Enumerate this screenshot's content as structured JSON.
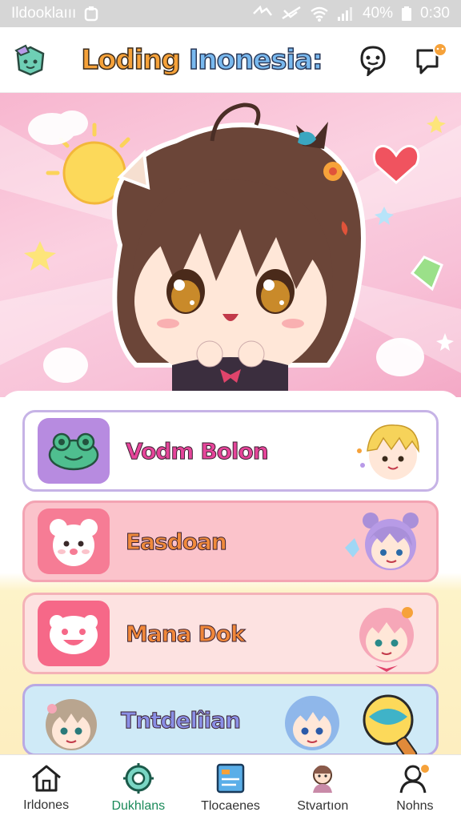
{
  "status_bar": {
    "carrier": "Ildooklaııı",
    "battery": "40%",
    "time": "0:30"
  },
  "header": {
    "title_part1": "Loding",
    "title_part2": "Inonesia:",
    "icons": [
      "chat-face-icon",
      "notification-icon"
    ]
  },
  "cards": [
    {
      "label": "Vodm Bolon",
      "icon": "frog-icon"
    },
    {
      "label": "Easdoan",
      "icon": "bear-icon"
    },
    {
      "label": "Mana Dok",
      "icon": "bear-face-icon"
    },
    {
      "label": "Tntdelîian",
      "icon": "chibi-girl-icon"
    }
  ],
  "bottom_nav": [
    {
      "label": "Irldones",
      "icon": "home-icon"
    },
    {
      "label": "Dukhlans",
      "icon": "gear-icon"
    },
    {
      "label": "Tlocaenes",
      "icon": "document-icon"
    },
    {
      "label": "Stvartıon",
      "icon": "character-icon"
    },
    {
      "label": "Nohns",
      "icon": "profile-icon"
    }
  ],
  "colors": {
    "accent_green": "#1b8a5a",
    "title_orange": "#f6a23a",
    "title_blue": "#79b9ef"
  }
}
